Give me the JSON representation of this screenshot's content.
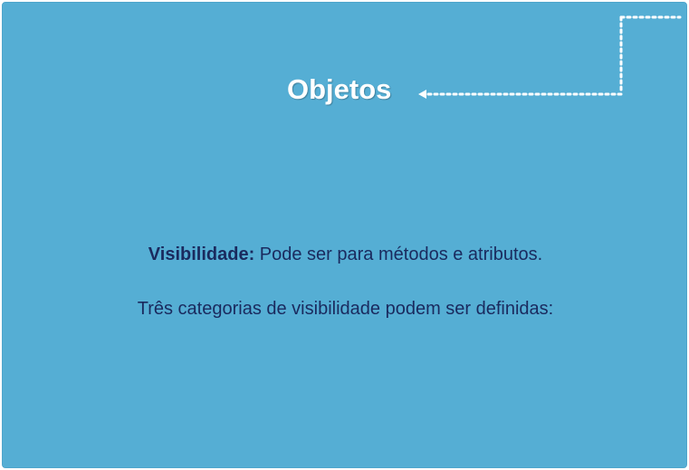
{
  "slide": {
    "title": "Objetos",
    "visibility_label": "Visibilidade:",
    "visibility_text": " Pode ser para métodos e atributos.",
    "categories_text": "Três categorias de visibilidade podem ser definidas:"
  },
  "colors": {
    "background": "#55aed4",
    "title": "#ffffff",
    "body_text": "#1a2a5e",
    "decoration": "#ffffff"
  },
  "icons": {
    "arrow": "dotted-arrow-icon"
  }
}
